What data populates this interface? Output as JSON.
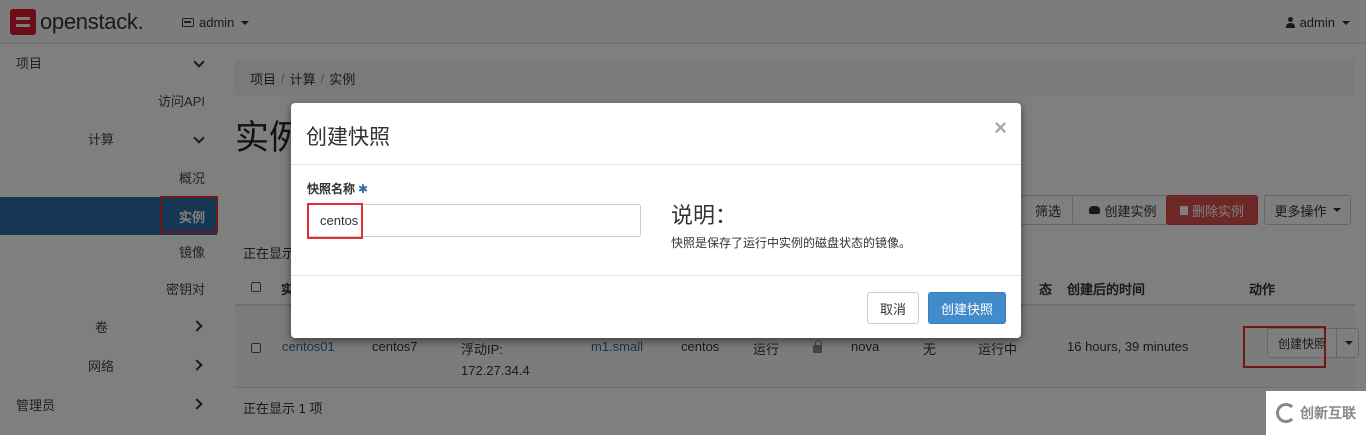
{
  "topbar": {
    "brand": "openstack.",
    "project_menu": "admin",
    "user_menu": "admin"
  },
  "sidebar": {
    "project": "项目",
    "api_access": "访问API",
    "compute": "计算",
    "overview": "概况",
    "instances": "实例",
    "images": "镜像",
    "keypairs": "密钥对",
    "volumes": "卷",
    "network": "网络",
    "admin": "管理员"
  },
  "breadcrumb": [
    "项目",
    "计算",
    "实例"
  ],
  "page": {
    "title": "实例",
    "showing_top": "正在显示",
    "showing_bottom": "正在显示 1 项"
  },
  "toolbar": {
    "filter": "筛选",
    "launch": "创建实例",
    "delete": "删除实例",
    "more": "更多操作"
  },
  "table": {
    "headers": {
      "name_partial": "实",
      "status_partial": "态",
      "age": "创建后的时间",
      "actions": "动作"
    },
    "row": {
      "name": "centos01",
      "image": "centos7",
      "ip_label": "浮动IP:",
      "ip": "172.27.34.4",
      "flavor": "m1.small",
      "keypair": "centos",
      "status": "运行",
      "zone": "nova",
      "task": "无",
      "power": "运行中",
      "age": "16 hours, 39 minutes",
      "action": "创建快照"
    }
  },
  "modal": {
    "title": "创建快照",
    "close": "×",
    "field_label": "快照名称",
    "required_mark": "✱",
    "field_value": "centos",
    "desc_title": "说明：",
    "desc_text": "快照是保存了运行中实例的磁盘状态的镜像。",
    "cancel": "取消",
    "submit": "创建快照"
  },
  "watermark": "创新互联",
  "colors": {
    "accent": "#2a6fa8",
    "danger": "#d9534f",
    "primary": "#428bca",
    "highlight": "#e03030"
  }
}
